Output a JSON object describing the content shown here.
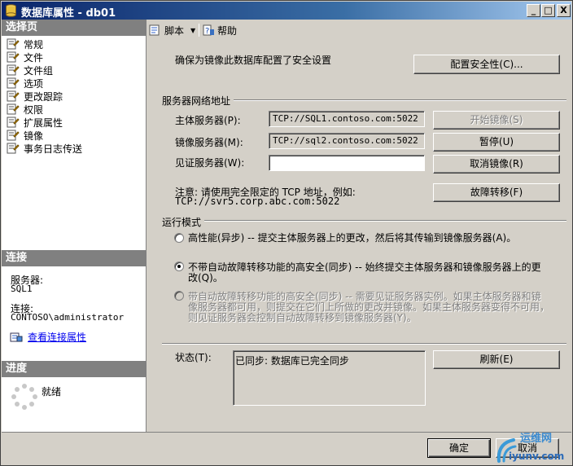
{
  "window": {
    "title": "数据库属性 - db01",
    "minimize": "_",
    "maximize": "□",
    "close": "X"
  },
  "sidebar": {
    "select_page_header": "选择页",
    "items": [
      {
        "label": "常规"
      },
      {
        "label": "文件"
      },
      {
        "label": "文件组"
      },
      {
        "label": "选项"
      },
      {
        "label": "更改跟踪"
      },
      {
        "label": "权限"
      },
      {
        "label": "扩展属性"
      },
      {
        "label": "镜像"
      },
      {
        "label": "事务日志传送"
      }
    ],
    "selected": "镜像",
    "connection_header": "连接",
    "server_label": "服务器:",
    "server_value": "SQL1",
    "connection_label": "连接:",
    "connection_value": "CONTOSO\\administrator",
    "view_connection_link": "查看连接属性",
    "progress_header": "进度",
    "progress_status": "就绪"
  },
  "toolbar": {
    "script_label": "脚本",
    "help_label": "帮助"
  },
  "main": {
    "security_note": "确保为镜像此数据库配置了安全设置",
    "configure_security_button": "配置安全性(C)...",
    "server_network_header": "服务器网络地址",
    "principal_label": "主体服务器(P):",
    "principal_value": "TCP://SQL1.contoso.com:5022",
    "mirror_label": "镜像服务器(M):",
    "mirror_value": "TCP://sql2.contoso.com:5022",
    "witness_label": "见证服务器(W):",
    "witness_value": "",
    "start_mirroring_button": "开始镜像(S)",
    "pause_button": "暂停(U)",
    "remove_mirroring_button": "取消镜像(R)",
    "failover_button": "故障转移(F)",
    "note_line1": "注意: 请使用完全限定的 TCP 地址，例如:",
    "note_line2": "TCP://svr5.corp.abc.com:5022",
    "operating_mode_header": "运行模式",
    "mode_high_performance": "高性能(异步) -- 提交主体服务器上的更改，然后将其传输到镜像服务器(A)。",
    "mode_high_safety_line1": "不带自动故障转移功能的高安全(同步) -- 始终提交主体服务器和镜像服务器上的更",
    "mode_high_safety_line2": "改(Q)。",
    "mode_auto_failover_line1": "带自动故障转移功能的高安全(同步) -- 需要见证服务器实例。如果主体服务器和镜",
    "mode_auto_failover_line2": "像服务器都可用，则提交在它们上所做的更改并镜像。如果主体服务器变得不可用，",
    "mode_auto_failover_line3": "则见证服务器会控制自动故障转移到镜像服务器(Y)。",
    "selected_mode": "high_safety",
    "status_label": "状态(T):",
    "status_value": "已同步: 数据库已完全同步",
    "refresh_button": "刷新(E)"
  },
  "footer": {
    "ok_button": "确定",
    "cancel_button": "取消"
  },
  "watermark": {
    "text_top": "运维网",
    "text_bottom": "iyunv.com"
  }
}
